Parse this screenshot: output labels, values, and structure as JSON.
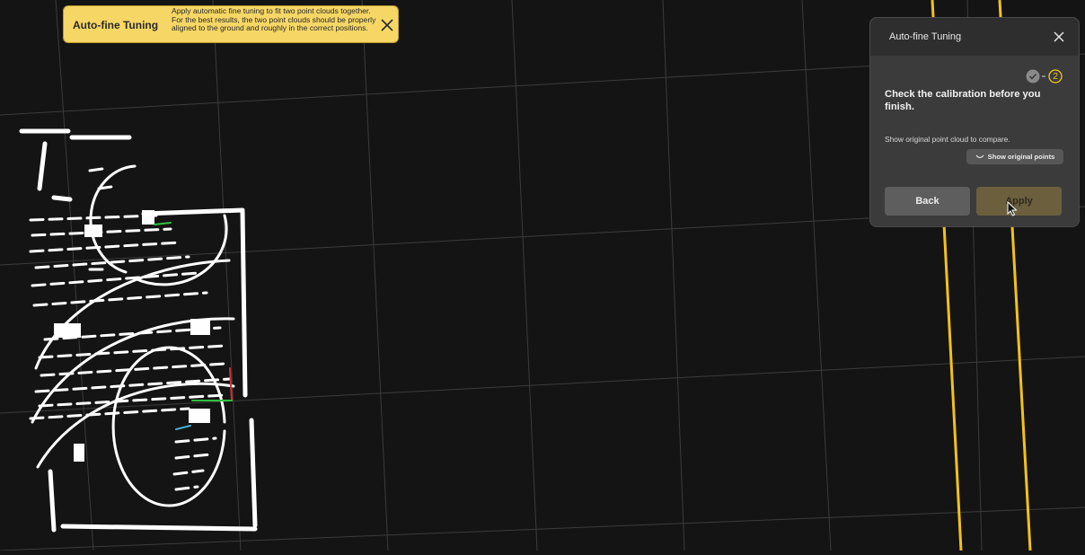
{
  "banner": {
    "title": "Auto-fine Tuning",
    "message": "Apply automatic fine tuning to fit two point clouds together. For the best results, the two point clouds should be properly aligned to the ground and roughly in the correct positions.",
    "close_icon": "close-icon",
    "color": "#f6d765"
  },
  "panel": {
    "title": "Auto-fine Tuning",
    "close_icon": "close-icon",
    "steps": {
      "completed_icon": "check-icon",
      "current": "2",
      "accent_color": "#f3c623"
    },
    "heading": "Check the calibration before you finish.",
    "description": "Show original point cloud to compare.",
    "toggle_label": "Show original points",
    "toggle_icon": "eye-closed-icon",
    "back_label": "Back",
    "apply_label": "Apply"
  },
  "scene": {
    "background": "#151414",
    "grid_color": "#3c3c3c",
    "point_color": "#ffffff",
    "guide_line_color": "#f2c21b"
  }
}
